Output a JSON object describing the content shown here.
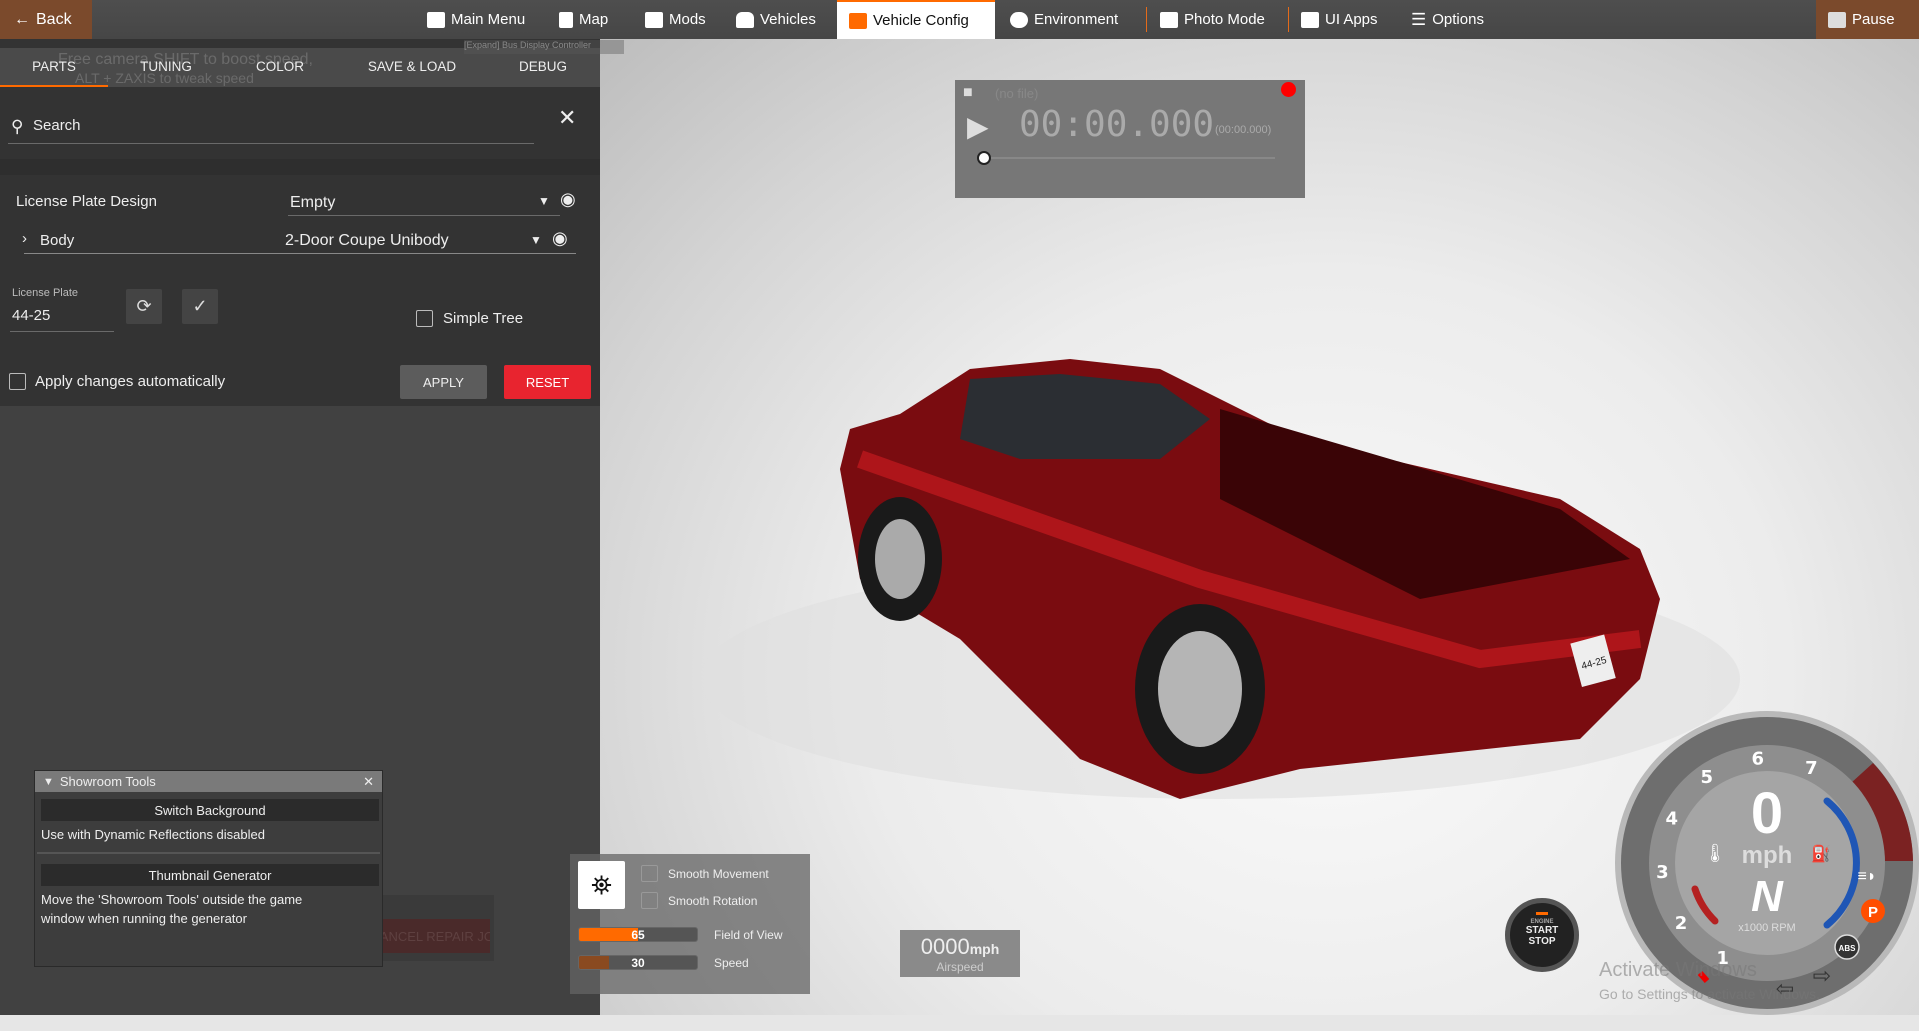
{
  "topbar": {
    "back": "Back",
    "items": [
      {
        "label": "Main Menu",
        "icon": "main-menu-icon"
      },
      {
        "label": "Map",
        "icon": "map-icon"
      },
      {
        "label": "Mods",
        "icon": "puzzle-icon"
      },
      {
        "label": "Vehicles",
        "icon": "car-icon"
      },
      {
        "label": "Vehicle Config",
        "icon": "engine-icon",
        "active": true
      },
      {
        "label": "Environment",
        "icon": "weather-icon"
      },
      {
        "label": "Photo Mode",
        "icon": "camera-icon"
      },
      {
        "label": "UI Apps",
        "icon": "ui-apps-icon"
      },
      {
        "label": "Options",
        "icon": "sliders-icon"
      }
    ],
    "pause": "Pause",
    "accent": "#ff6a00"
  },
  "tabs": [
    "PARTS",
    "TUNING",
    "COLOR",
    "SAVE & LOAD",
    "DEBUG"
  ],
  "overlay": {
    "camera_hint_1": "Free camera  SHIFT  to boost speed,",
    "camera_hint_2": "ALT + ZAXIS  to tweak speed",
    "bus_controller": "[Expand] Bus Display Controller"
  },
  "search": {
    "placeholder": "Search"
  },
  "parts": [
    {
      "label": "License Plate Design",
      "value": "Empty"
    },
    {
      "label": "Body",
      "value": "2-Door Coupe Unibody"
    }
  ],
  "license": {
    "label": "License Plate",
    "value": "44-25"
  },
  "simple_tree": "Simple Tree",
  "apply_auto": "Apply changes automatically",
  "apply": "APPLY",
  "reset": "RESET",
  "reset_color": "#e8242f",
  "ghost_button": "CANCEL REPAIR JOB",
  "showroom": {
    "title": "Showroom Tools",
    "switch_bg": "Switch Background",
    "switch_note": "Use with Dynamic Reflections disabled",
    "thumb": "Thumbnail Generator",
    "thumb_note_1": "Move the 'Showroom Tools' outside the game",
    "thumb_note_2": "window when running the generator"
  },
  "camera": {
    "smooth_move": "Smooth Movement",
    "smooth_rot": "Smooth Rotation",
    "fov_label": "Field of View",
    "fov": "65",
    "speed_label": "Speed",
    "speed": "30"
  },
  "airspeed": {
    "value": "0000",
    "unit": "mph",
    "label": "Airspeed"
  },
  "recorder": {
    "file": "(no file)",
    "time": "00:00.000",
    "total": "(00:00.000)"
  },
  "engine": {
    "l1": "ENGINE",
    "l2": "START",
    "l3": "STOP"
  },
  "gauge": {
    "speed": "0",
    "unit": "mph",
    "gear": "N",
    "rpm_label": "x1000 RPM",
    "ticks": [
      "1",
      "2",
      "3",
      "4",
      "5",
      "6",
      "7"
    ],
    "abs": "ABS",
    "park": "P"
  },
  "watermark": {
    "l1": "Activate Windows",
    "l2": "Go to Settings to activate Windows."
  },
  "plate_on_car": "44-25"
}
